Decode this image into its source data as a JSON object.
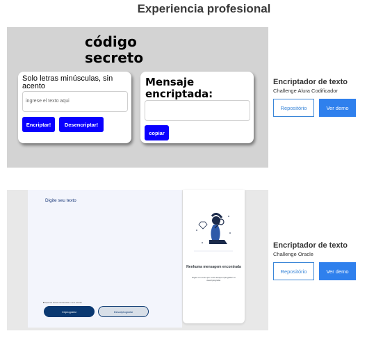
{
  "section": {
    "title": "Experiencia profesional"
  },
  "projects": [
    {
      "name": "Encriptador de texto",
      "description": "Challenge Alura Codificador",
      "repo_label": "Repositório",
      "demo_label": "Ver demo",
      "preview": {
        "title_line1": "código",
        "title_line2": "secreto",
        "hint": "Solo letras minúsculas, sin acento",
        "input_placeholder": "ingrese el texto aqui",
        "encrypt_label": "Encriptar!",
        "decrypt_label": "Desencriptar!",
        "message_heading": "Mensaje encriptada:",
        "copy_label": "copiar",
        "colors": {
          "background": "#d3d3d3",
          "button": "#0a00ff"
        }
      }
    },
    {
      "name": "Encriptador de texto",
      "description": "Challenge Oracle",
      "repo_label": "Repositório",
      "demo_label": "Ver demo",
      "preview": {
        "prompt": "Digite seu texto",
        "note": "Apenas letras minúsculas e sem acento",
        "encrypt_label": "Criptografar",
        "decrypt_label": "Descriptografar",
        "empty_title": "Nenhuma mensagem encontrada",
        "empty_sub": "Digite um texto que você deseja criptografar ou descriptografar.",
        "colors": {
          "primary": "#0a3871",
          "panel": "#f3f5fc"
        }
      }
    }
  ],
  "colors": {
    "accent": "#2f80ed",
    "outline": "#3a86d8"
  }
}
